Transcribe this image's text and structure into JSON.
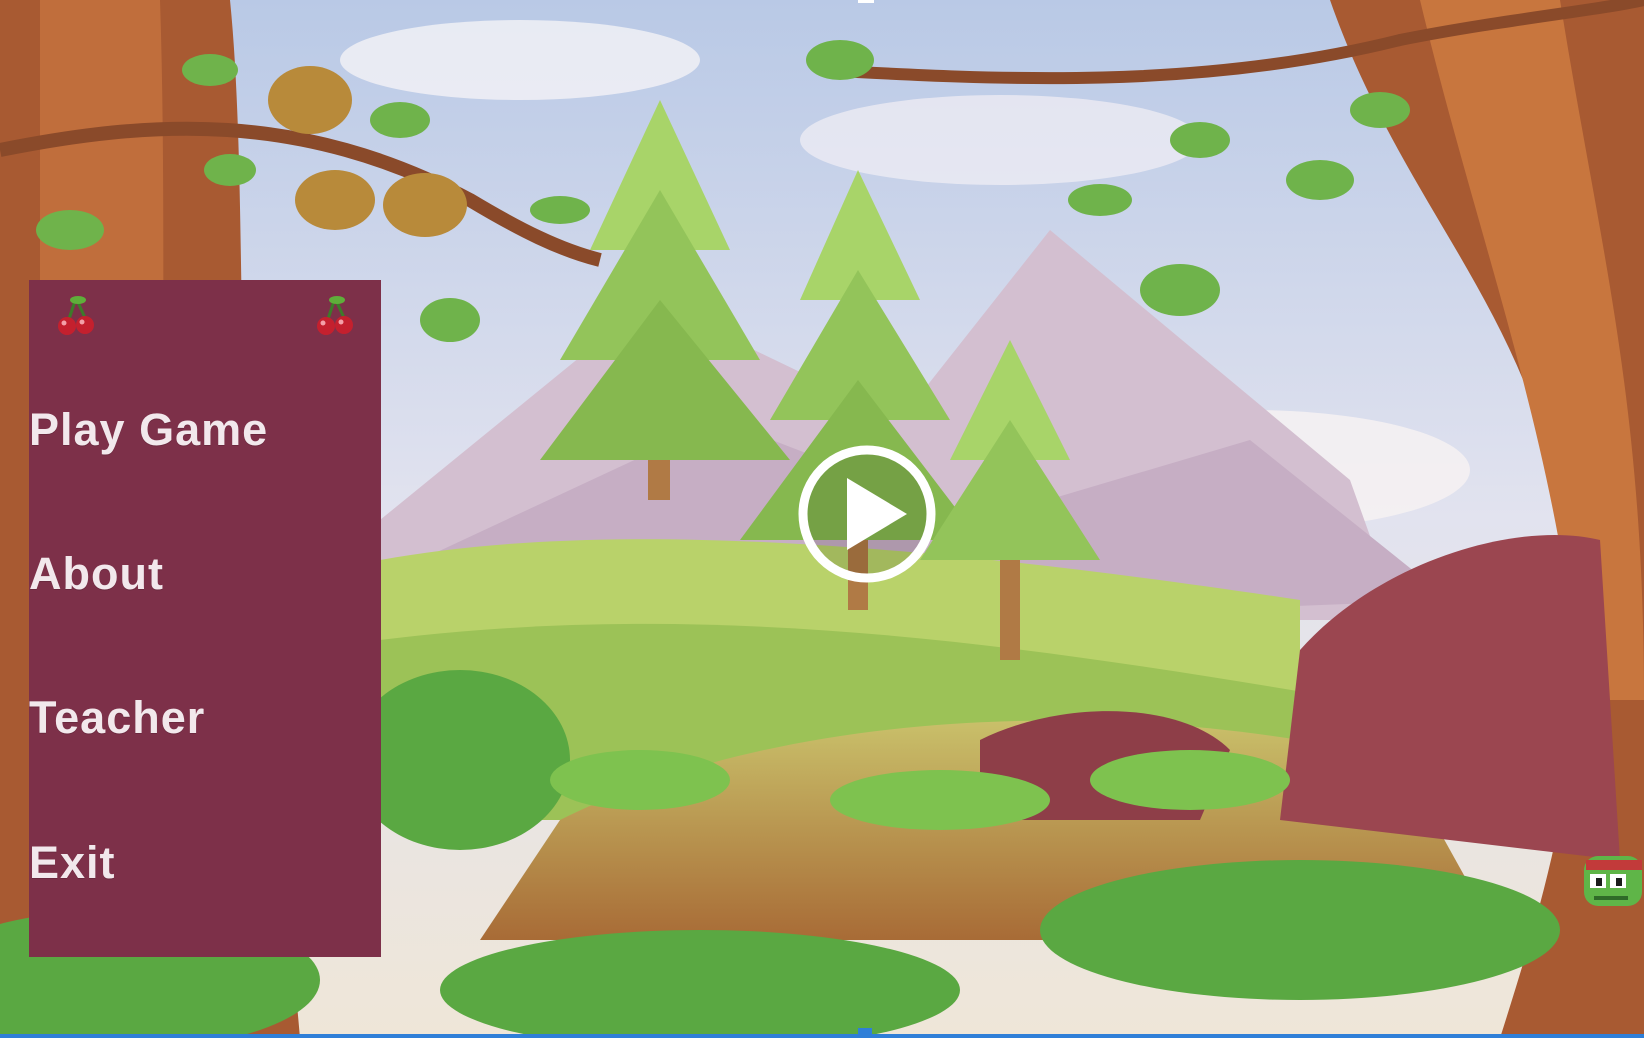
{
  "menu": {
    "items": [
      {
        "label": "Play Game"
      },
      {
        "label": "About"
      },
      {
        "label": "Teacher"
      },
      {
        "label": "Exit"
      }
    ]
  },
  "colors": {
    "panel": "#7d3049",
    "menu_text": "#f2e8ec",
    "accent": "#2f7fd8"
  },
  "icons": [
    "cherry-icon",
    "cherry-icon",
    "play-icon",
    "frog-character-icon"
  ]
}
